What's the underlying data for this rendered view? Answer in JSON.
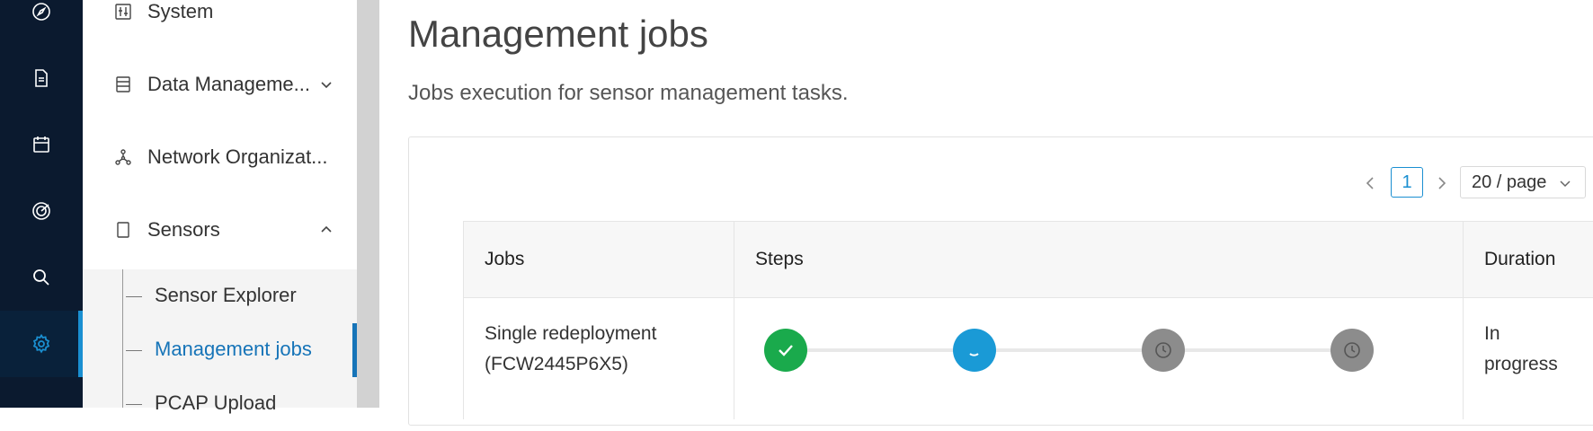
{
  "sidebar": {
    "items": [
      {
        "label": "System",
        "icon": "system-settings-icon"
      },
      {
        "label": "Data Manageme...",
        "icon": "database-icon"
      },
      {
        "label": "Network Organizat...",
        "icon": "network-icon"
      },
      {
        "label": "Sensors",
        "icon": "sensor-icon"
      }
    ],
    "sensors_children": [
      {
        "label": "Sensor Explorer"
      },
      {
        "label": "Management jobs"
      },
      {
        "label": "PCAP Upload"
      }
    ]
  },
  "main": {
    "title": "Management jobs",
    "subtitle": "Jobs execution for sensor management tasks.",
    "pagination": {
      "current_page": "1",
      "page_size": "20 / page"
    },
    "table": {
      "columns": [
        "Jobs",
        "Steps",
        "Duration"
      ],
      "rows": [
        {
          "job_line1": "Single redeployment",
          "job_line2": "(FCW2445P6X5)",
          "steps": [
            "done",
            "running",
            "pending",
            "pending"
          ],
          "duration_line1": "In",
          "duration_line2": "progress"
        }
      ]
    }
  },
  "colors": {
    "rail_bg": "#0b1a2f",
    "accent": "#1a8fd1",
    "active_text": "#1674b8",
    "step_done": "#1aaa4c",
    "step_running": "#1a9ad6",
    "step_pending": "#8c8c8c"
  }
}
